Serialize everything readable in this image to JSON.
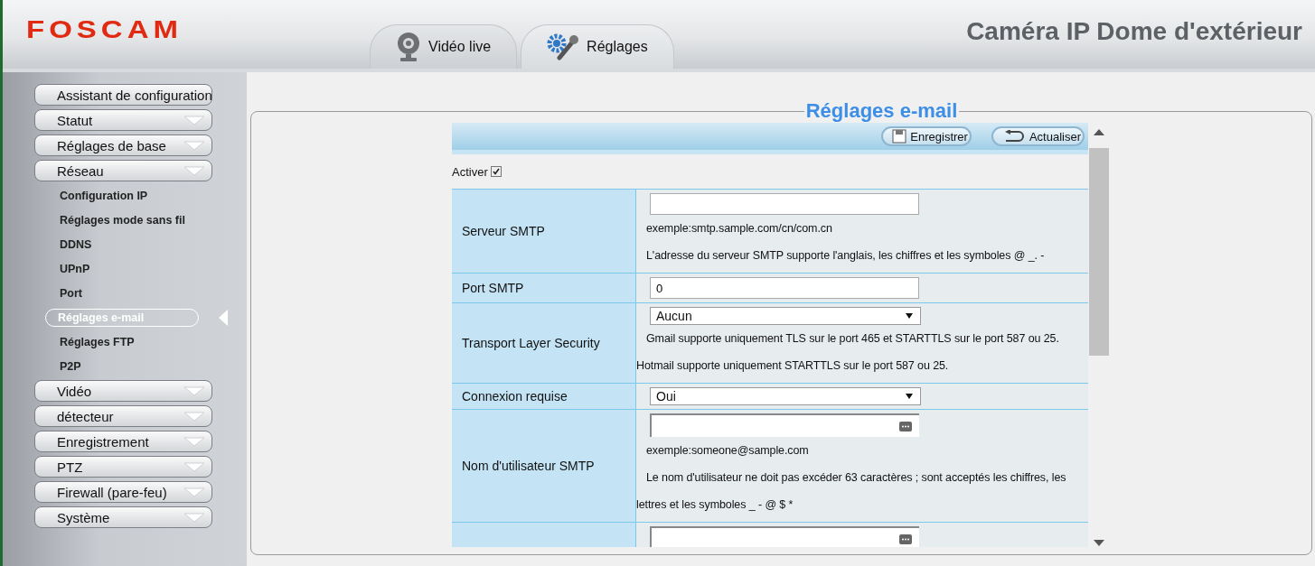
{
  "header": {
    "logo": "FOSCAM",
    "title": "Caméra IP Dome d'extérieur",
    "tabs": [
      {
        "label": "Vidéo live",
        "selected": false
      },
      {
        "label": "Réglages",
        "selected": true
      }
    ]
  },
  "sidebar": {
    "items": [
      {
        "label": "Assistant de configuration",
        "kind": "single"
      },
      {
        "label": "Statut",
        "kind": "group"
      },
      {
        "label": "Réglages de base",
        "kind": "group"
      },
      {
        "label": "Réseau",
        "kind": "group",
        "children": [
          {
            "label": "Configuration IP",
            "selected": false
          },
          {
            "label": "Réglages mode sans fil",
            "selected": false
          },
          {
            "label": "DDNS",
            "selected": false
          },
          {
            "label": "UPnP",
            "selected": false
          },
          {
            "label": "Port",
            "selected": false
          },
          {
            "label": "Réglages e-mail",
            "selected": true
          },
          {
            "label": "Réglages FTP",
            "selected": false
          },
          {
            "label": "P2P",
            "selected": false
          }
        ]
      },
      {
        "label": "Vidéo",
        "kind": "group"
      },
      {
        "label": "détecteur",
        "kind": "group"
      },
      {
        "label": "Enregistrement",
        "kind": "group"
      },
      {
        "label": "PTZ",
        "kind": "group"
      },
      {
        "label": "Firewall (pare-feu)",
        "kind": "group"
      },
      {
        "label": "Système",
        "kind": "group"
      }
    ]
  },
  "panel": {
    "title": "Réglages e-mail",
    "buttons": [
      {
        "label": "Enregistrer"
      },
      {
        "label": "Actualiser"
      }
    ],
    "enable": {
      "label": "Activer",
      "checked": true
    },
    "rows": [
      {
        "label": "Serveur SMTP",
        "kind": "text",
        "value": "",
        "notes": [
          "exemple:smtp.sample.com/cn/com.cn",
          "L'adresse du serveur SMTP supporte l'anglais, les chiffres et les symboles @ _. -"
        ]
      },
      {
        "label": "Port SMTP",
        "kind": "text",
        "value": "0",
        "notes": []
      },
      {
        "label": "Transport Layer Security",
        "kind": "select",
        "value": "Aucun",
        "notes": [
          "Gmail supporte uniquement TLS sur le port 465 et STARTTLS sur le port 587 ou 25.",
          "Hotmail supporte uniquement STARTTLS sur le port 587 ou 25."
        ]
      },
      {
        "label": "Connexion requise",
        "kind": "select",
        "value": "Oui",
        "notes": []
      },
      {
        "label": "Nom d'utilisateur SMTP",
        "kind": "credential",
        "value": "",
        "notes": [
          "exemple:someone@sample.com",
          "Le nom d'utilisateur ne doit pas excéder 63 caractères ; sont acceptés les chiffres, les",
          "lettres et les symboles _ - @ $ *"
        ]
      },
      {
        "kind": "credential",
        "value": "",
        "notes": []
      }
    ]
  }
}
